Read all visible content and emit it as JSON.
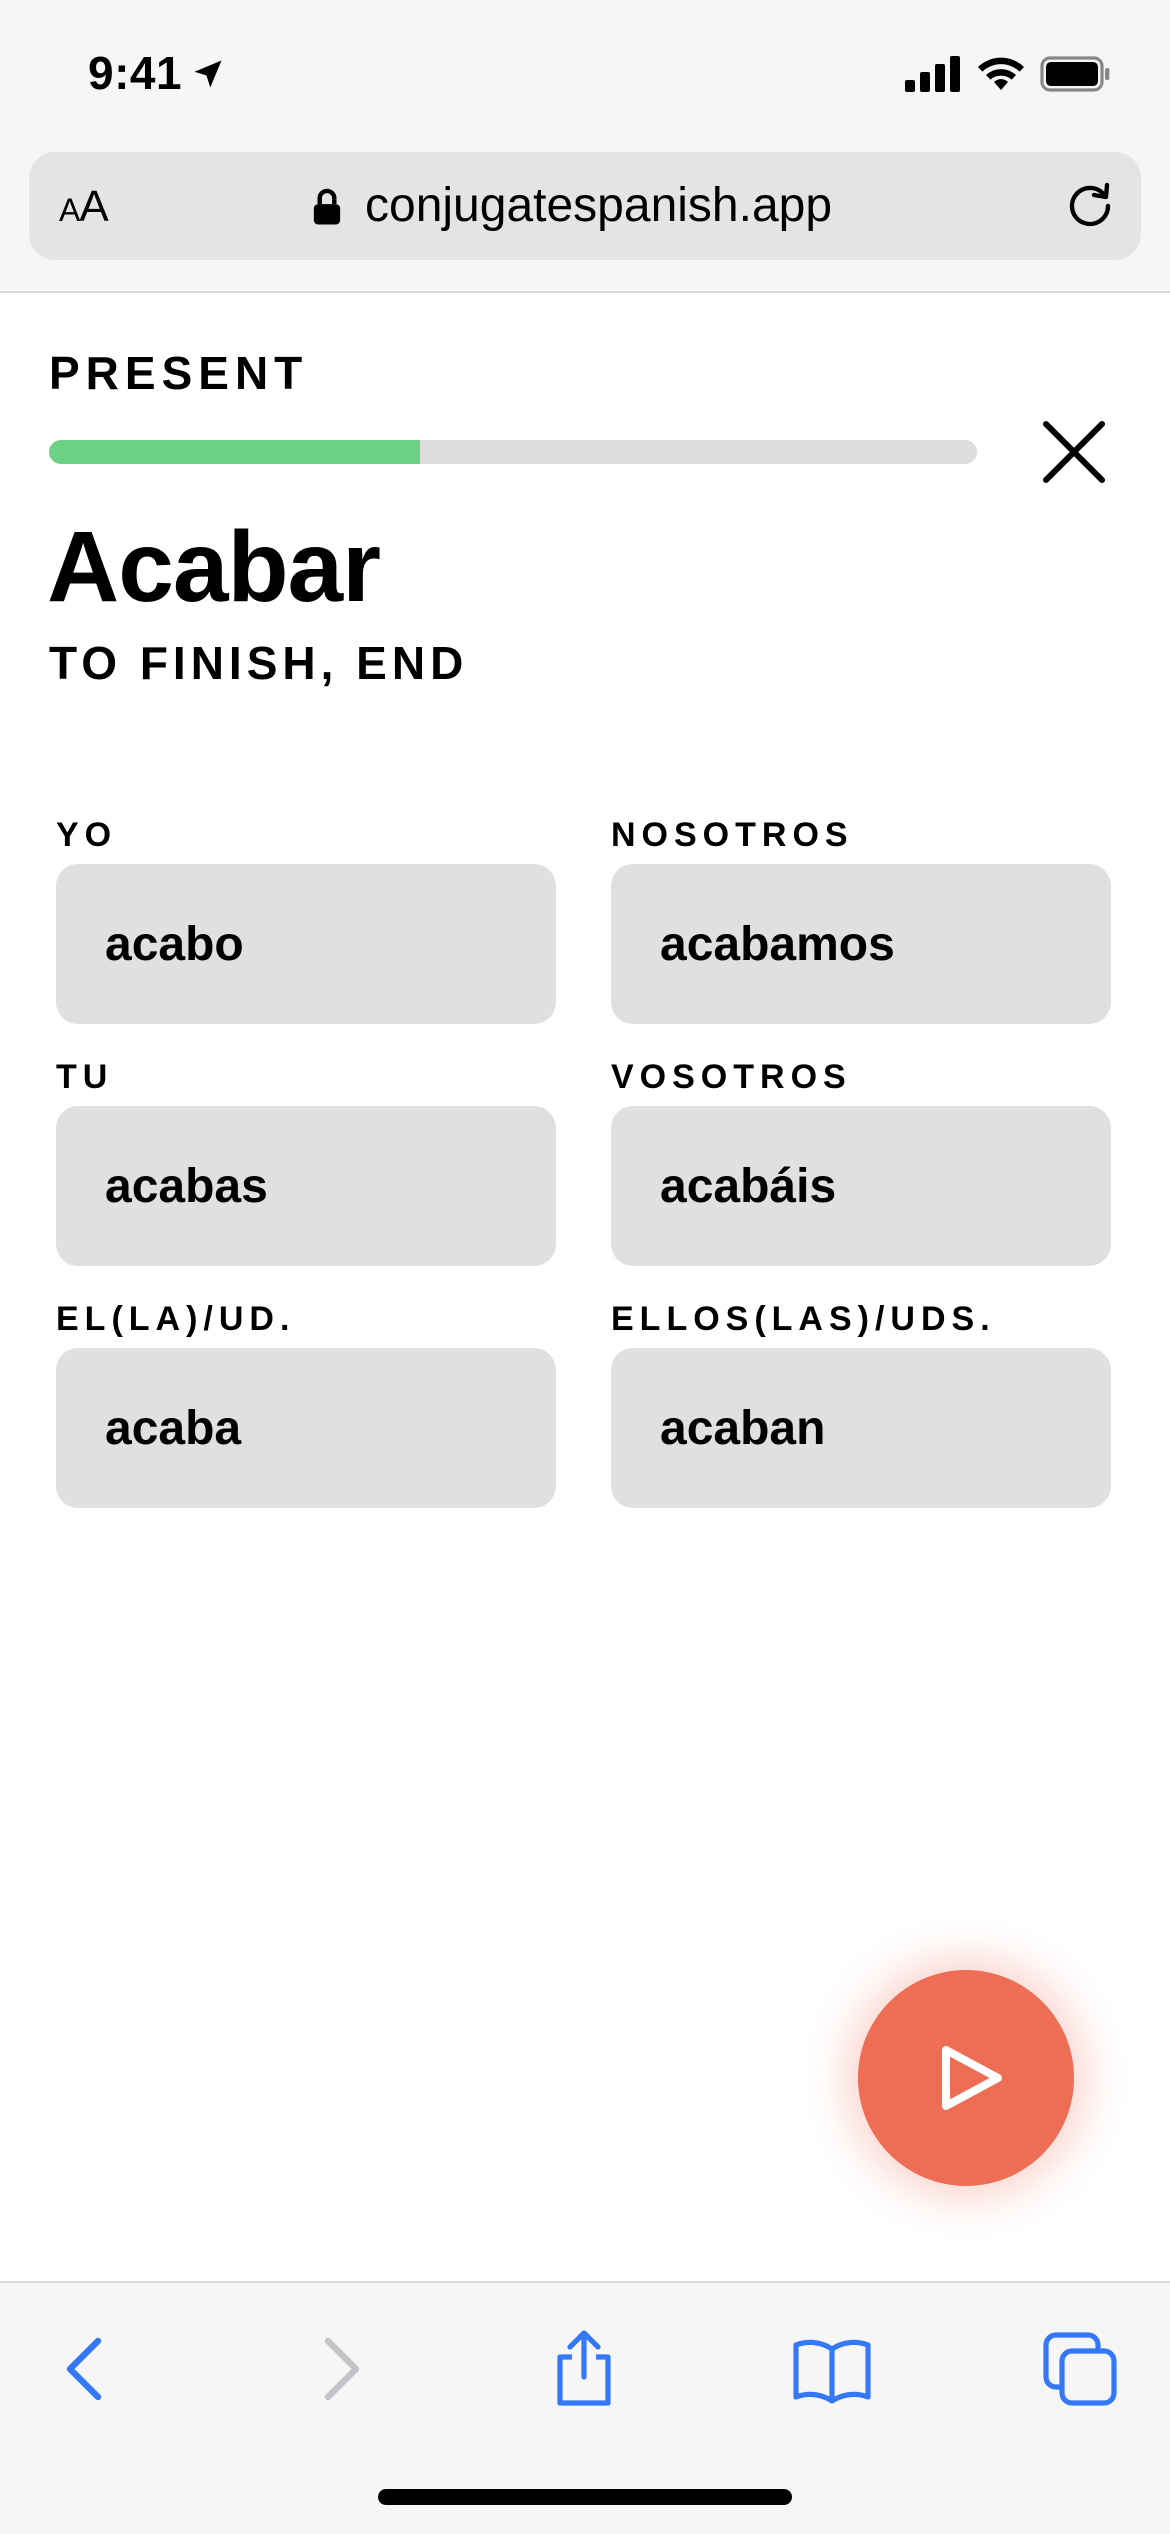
{
  "status_bar": {
    "time": "9:41"
  },
  "browser": {
    "text_size_label_small": "A",
    "text_size_label_large": "A",
    "url": "conjugatespanish.app"
  },
  "quiz": {
    "tense": "PRESENT",
    "progress": 0.4,
    "verb": "Acabar",
    "translation": "TO FINISH, END",
    "pronouns": [
      {
        "label": "YO",
        "answer": "acabo"
      },
      {
        "label": "NOSOTROS",
        "answer": "acabamos"
      },
      {
        "label": "TU",
        "answer": "acabas"
      },
      {
        "label": "VOSOTROS",
        "answer": "acabáis"
      },
      {
        "label": "EL(LA)/UD.",
        "answer": "acaba"
      },
      {
        "label": "ELLOS(LAS)/UDS.",
        "answer": "acaban"
      }
    ]
  },
  "colors": {
    "progress_fill": "#6dd384",
    "play_button": "#ee6e55",
    "toolbar_active": "#3478f6",
    "toolbar_disabled": "#c4c4c8"
  },
  "toolbar": {
    "icons": [
      "back-icon",
      "forward-icon",
      "share-icon",
      "bookmarks-icon",
      "tabs-icon"
    ]
  }
}
